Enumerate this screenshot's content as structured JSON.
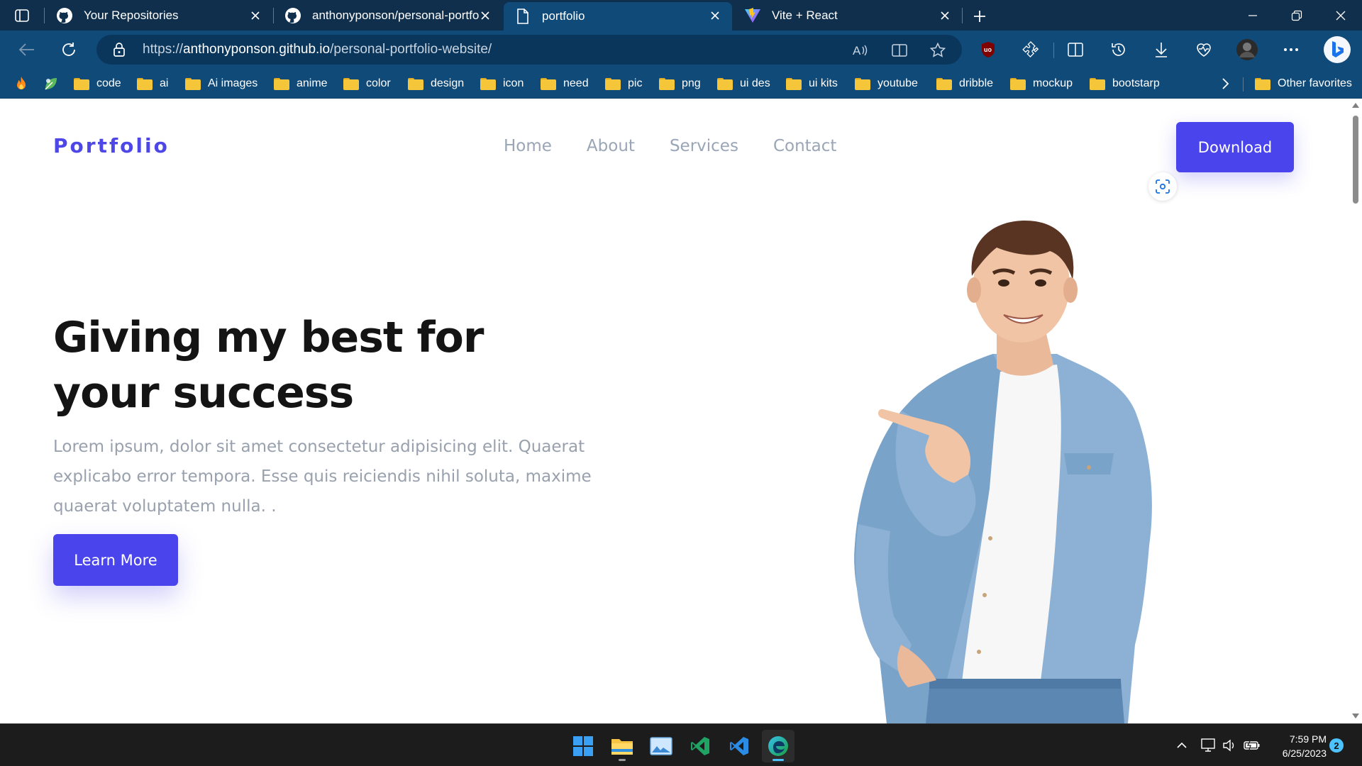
{
  "browser": {
    "tabs": [
      {
        "label": "Your Repositories",
        "icon": "github-icon",
        "active": false
      },
      {
        "label": "anthonyponson/personal-portfol",
        "icon": "github-icon",
        "active": false
      },
      {
        "label": "portfolio",
        "icon": "page-icon",
        "active": true
      },
      {
        "label": "Vite + React",
        "icon": "vite-icon",
        "active": false
      }
    ],
    "url": {
      "scheme": "https://",
      "host": "anthonyponson.github.io",
      "path": "/personal-portfolio-website/"
    },
    "bookmarks": [
      {
        "label": "code"
      },
      {
        "label": "ai"
      },
      {
        "label": "Ai images"
      },
      {
        "label": "anime"
      },
      {
        "label": "color"
      },
      {
        "label": "design"
      },
      {
        "label": "icon"
      },
      {
        "label": "need"
      },
      {
        "label": "pic"
      },
      {
        "label": "png"
      },
      {
        "label": "ui des"
      },
      {
        "label": "ui kits"
      },
      {
        "label": "youtube"
      },
      {
        "label": "dribble"
      },
      {
        "label": "mockup"
      },
      {
        "label": "bootstarp"
      }
    ],
    "other_favorites": "Other favorites"
  },
  "page": {
    "logo": "Portfolio",
    "nav": [
      "Home",
      "About",
      "Services",
      "Contact"
    ],
    "download_label": "Download",
    "headline_line1": "Giving my best for",
    "headline_line2": "your success",
    "lead": "Lorem ipsum, dolor sit amet consectetur adipisicing elit. Quaerat explicabo error tempora. Esse quis reiciendis nihil soluta, maxime quaerat voluptatem nulla. .",
    "learn_more_label": "Learn More",
    "accent_color": "#4a44ec"
  },
  "taskbar": {
    "apps": [
      "windows-start-icon",
      "file-explorer-icon",
      "photos-icon",
      "visual-studio-icon",
      "vscode-icon",
      "edge-icon"
    ],
    "time": "7:59 PM",
    "date": "6/25/2023",
    "notifications": "2"
  }
}
